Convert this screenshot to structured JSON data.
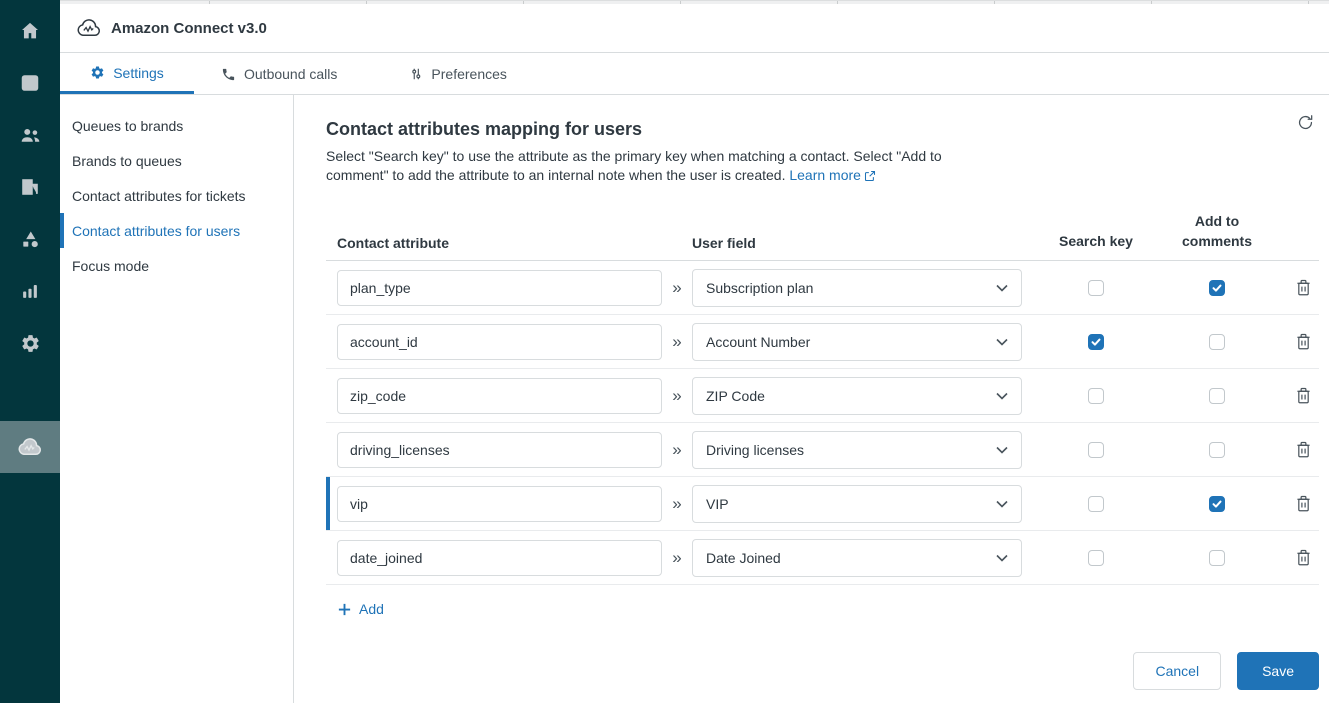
{
  "app": {
    "title": "Amazon Connect v3.0"
  },
  "colors": {
    "accent_blue": "#1f73b7",
    "sidebar_teal": "#03363d",
    "sidebar_active_bg": "#5f7c81",
    "border_gray": "#d8dcde",
    "text_dark": "#2f3941",
    "text_muted": "#49545c"
  },
  "sidebar": {
    "icons": [
      "home",
      "tickets",
      "customers",
      "organizations",
      "objects",
      "reporting",
      "admin"
    ],
    "active_app_icon": "amazon-connect-cloud"
  },
  "tabs": [
    {
      "label": "Settings",
      "icon": "gear",
      "active": true
    },
    {
      "label": "Outbound calls",
      "icon": "phone",
      "active": false
    },
    {
      "label": "Preferences",
      "icon": "sliders",
      "active": false
    }
  ],
  "nav": {
    "items": [
      "Queues to brands",
      "Brands to queues",
      "Contact attributes for tickets",
      "Contact attributes for users",
      "Focus mode"
    ],
    "active_index": 3
  },
  "main": {
    "title": "Contact attributes mapping for users",
    "description": "Select \"Search key\" to use the attribute as the primary key when matching a contact. Select \"Add to comment\" to add the attribute to an internal note when the user is created.",
    "learn_more_label": "Learn more",
    "refresh_icon": "refresh",
    "table": {
      "headers": {
        "contact_attribute": "Contact attribute",
        "user_field": "User field",
        "search_key": "Search key",
        "add_to_comments": "Add to comments"
      },
      "rows": [
        {
          "attribute": "plan_type",
          "user_field": "Subscription plan",
          "search_key": false,
          "add_to_comments": true,
          "selected": false
        },
        {
          "attribute": "account_id",
          "user_field": "Account Number",
          "search_key": true,
          "add_to_comments": false,
          "selected": false
        },
        {
          "attribute": "zip_code",
          "user_field": "ZIP Code",
          "search_key": false,
          "add_to_comments": false,
          "selected": false
        },
        {
          "attribute": "driving_licenses",
          "user_field": "Driving licenses",
          "search_key": false,
          "add_to_comments": false,
          "selected": false
        },
        {
          "attribute": "vip",
          "user_field": "VIP",
          "search_key": false,
          "add_to_comments": true,
          "selected": true
        },
        {
          "attribute": "date_joined",
          "user_field": "Date Joined",
          "search_key": false,
          "add_to_comments": false,
          "selected": false
        }
      ]
    },
    "add_label": "Add",
    "cancel_label": "Cancel",
    "save_label": "Save"
  }
}
